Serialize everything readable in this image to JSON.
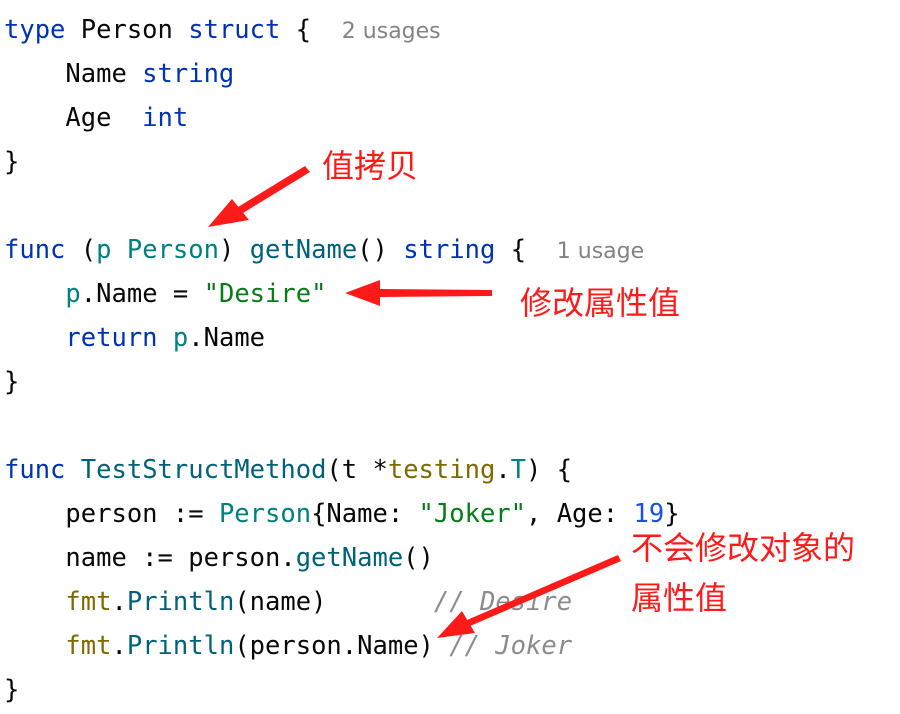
{
  "code": {
    "l1": {
      "kw": "type",
      "name": " Person ",
      "kw2": "struct",
      "brace": " {  ",
      "hint": "2 usages"
    },
    "l2": {
      "field": "    Name ",
      "type": "string"
    },
    "l3": {
      "field": "    Age  ",
      "type": "int"
    },
    "l4": {
      "text": "}"
    },
    "l6": {
      "kw": "func",
      "open": " (",
      "recv": "p",
      "sp": " ",
      "rtype": "Person",
      "close": ") ",
      "fn": "getName",
      "parens": "() ",
      "ret": "string",
      "brace": " {  ",
      "hint": "1 usage"
    },
    "l7": {
      "indent": "    ",
      "p": "p",
      "rest": ".Name = ",
      "str": "\"Desire\""
    },
    "l8": {
      "indent": "    ",
      "kw": "return",
      "sp": " ",
      "p": "p",
      "rest": ".Name"
    },
    "l9": {
      "text": "}"
    },
    "l11": {
      "kw": "func",
      "sp": " ",
      "fn": "TestStructMethod",
      "open": "(t *",
      "pkg": "testing",
      "dot": ".",
      "t": "T",
      "close": ") {"
    },
    "l12": {
      "pre": "    person := ",
      "type": "Person",
      "mid1": "{Name: ",
      "str": "\"Joker\"",
      "mid2": ", Age: ",
      "num": "19",
      "end": "}"
    },
    "l13": {
      "pre": "    name := person.",
      "fn": "getName",
      "end": "()"
    },
    "l14": {
      "indent": "    ",
      "pkg": "fmt",
      "dot": ".",
      "fn": "Println",
      "args": "(name)       ",
      "cmt": "// Desire"
    },
    "l15": {
      "indent": "    ",
      "pkg": "fmt",
      "dot": ".",
      "fn": "Println",
      "args": "(person.Name) ",
      "cmt": "// Joker"
    },
    "l16": {
      "text": "}"
    }
  },
  "annotations": {
    "value_copy": "值拷贝",
    "modify_field": "修改属性值",
    "no_modify_line1": "不会修改对象的",
    "no_modify_line2": "属性值"
  },
  "colors": {
    "keyword": "#0033b3",
    "function": "#00627a",
    "parameter": "#008080",
    "string": "#067d17",
    "number": "#1750eb",
    "package": "#7f6a00",
    "comment": "#8c8c8c",
    "annotation": "#ff1a1a"
  }
}
